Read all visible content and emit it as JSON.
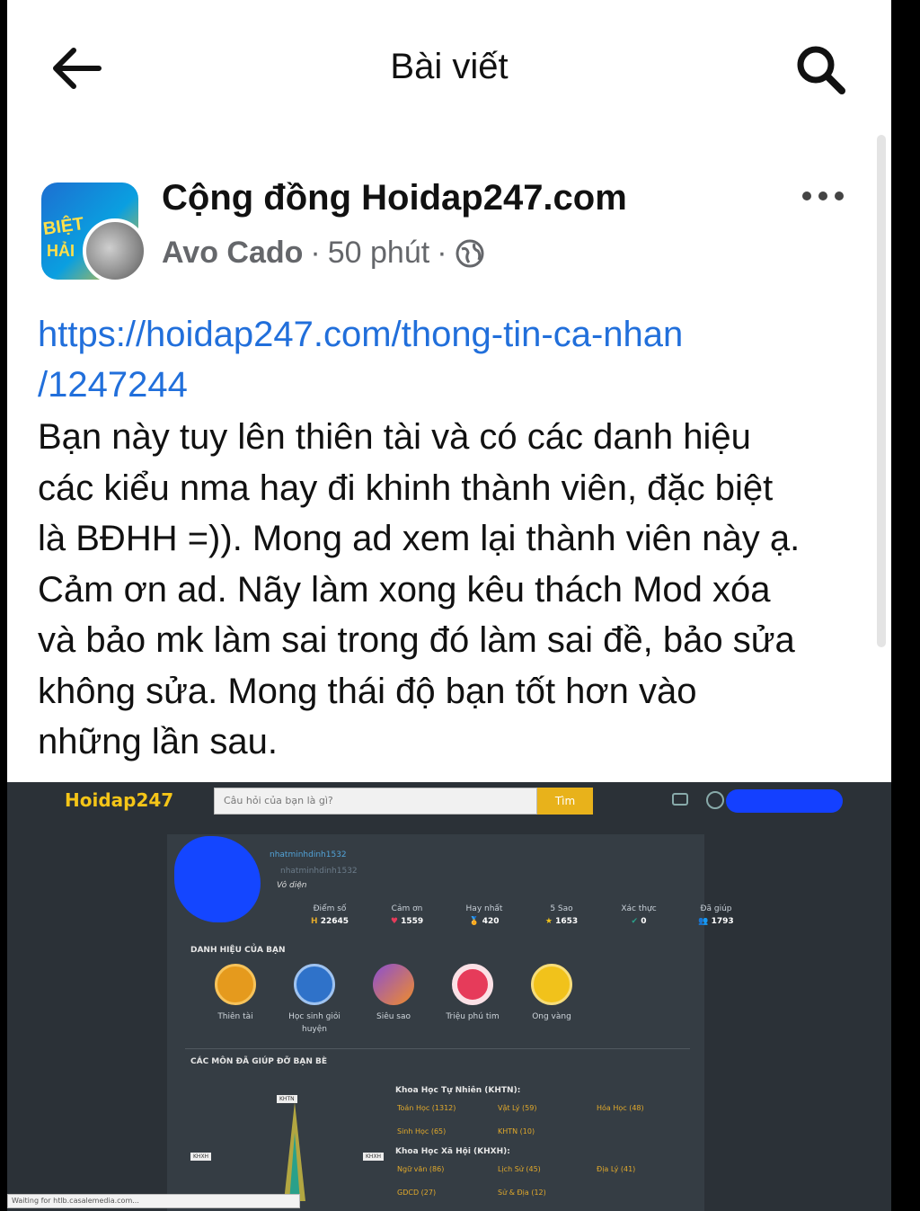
{
  "header": {
    "title": "Bài viết"
  },
  "post": {
    "group_name": "Cộng đồng Hoidap247.com",
    "author": "Avo Cado",
    "time": "50 phút",
    "separator": "·",
    "link_line1": "https://hoidap247.com/thong-tin-ca-nhan",
    "link_line2": "/1247244",
    "body_lines": [
      "Bạn này tuy lên thiên tài và có các danh hiệu",
      "các kiểu nma hay đi khinh thành viên, đặc biệt",
      "là BĐHH =)). Mong ad xem lại thành viên này ạ.",
      "Cảm ơn ad. Nãy làm xong kêu thách Mod xóa",
      "và bảo mk làm sai trong đó làm sai đề, bảo sửa",
      "không sửa. Mong thái độ bạn tốt hơn vào",
      "những lần sau."
    ],
    "avatar_text": [
      "BIỆT",
      "HẢI"
    ]
  },
  "screenshot": {
    "logo": "Hoidap247",
    "search_placeholder": "Câu hỏi của bạn là gì?",
    "search_button": "Tìm",
    "username": "nhatminhdinh1532",
    "handle": "nhatminhdinh1532",
    "user_title": "Vô diện",
    "stats": [
      {
        "label": "Điểm số",
        "value": "22645",
        "icon": "H"
      },
      {
        "label": "Cảm ơn",
        "value": "1559",
        "icon": "♥"
      },
      {
        "label": "Hay nhất",
        "value": "420",
        "icon": "🏅"
      },
      {
        "label": "5 Sao",
        "value": "1653",
        "icon": "★"
      },
      {
        "label": "Xác thực",
        "value": "0",
        "icon": "✔"
      },
      {
        "label": "Đã giúp",
        "value": "1793",
        "icon": "👥"
      }
    ],
    "badges_title": "DANH HIỆU CỦA BẠN",
    "badges": [
      {
        "label": "Thiên tài",
        "color": "#e59a1d"
      },
      {
        "label": "Học sinh giỏi huyện",
        "color": "#2f72c9"
      },
      {
        "label": "Siêu sao",
        "color": "#8b4fd2"
      },
      {
        "label": "Triệu phú tim",
        "color": "#e63b5a"
      },
      {
        "label": "Ong vàng",
        "color": "#f1c21b"
      }
    ],
    "subjects_title": "CÁC MÔN ĐÃ GIÚP ĐỠ BẠN BÈ",
    "chart_tags": [
      "KHTN",
      "KHXH",
      "KHXH"
    ],
    "khtn_title": "Khoa Học Tự Nhiên (KHTN):",
    "khtn_subjects": [
      "Toán Học (1312)",
      "Vật Lý (59)",
      "Hóa Học (48)",
      "Sinh Học (65)",
      "KHTN (10)"
    ],
    "khxh_title": "Khoa Học Xã Hội (KHXH):",
    "khxh_subjects": [
      "Ngữ văn (86)",
      "Lịch Sử (45)",
      "Địa Lý (41)",
      "GDCD (27)",
      "Sử & Địa (12)"
    ],
    "status_text": "Waiting for htlb.casalemedia.com..."
  }
}
